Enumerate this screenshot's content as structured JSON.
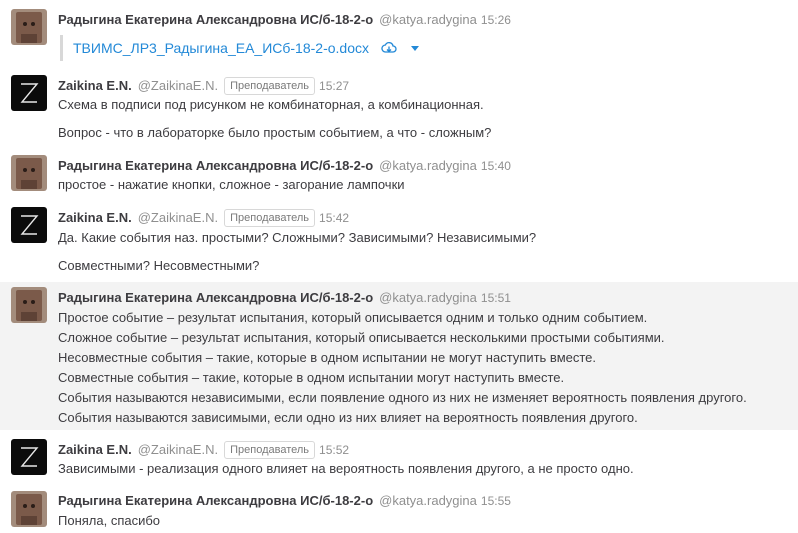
{
  "file": {
    "name": "ТВИМС_ЛР3_Радыгина_ЕА_ИСб-18-2-о.docx",
    "download_icon": "cloud-download-icon",
    "menu_icon": "caret-down-icon"
  },
  "posts": [
    {
      "name": "Радыгина Екатерина Александровна ИС/б-18-2-о",
      "handle": "@katya.radygina",
      "time": "15:26",
      "avatar": "avatar-photo"
    },
    {
      "name": "Zaikina E.N.",
      "handle": "@ZaikinaE.N.",
      "badge": "Преподаватель",
      "time": "15:27",
      "avatar": "avatar-logo",
      "lines": [
        "Схема в подписи под рисунком не комбинаторная, а комбинационная.",
        "Вопрос - что в лабораторке было простым событием, а что - сложным?"
      ]
    },
    {
      "name": "Радыгина Екатерина Александровна ИС/б-18-2-о",
      "handle": "@katya.radygina",
      "time": "15:40",
      "avatar": "avatar-photo",
      "lines": [
        "простое - нажатие кнопки, сложное - загорание лампочки"
      ]
    },
    {
      "name": "Zaikina E.N.",
      "handle": "@ZaikinaE.N.",
      "badge": "Преподаватель",
      "time": "15:42",
      "avatar": "avatar-logo",
      "lines": [
        "Да. Какие события наз. простыми? Сложными? Зависимыми? Независимыми?",
        "Совместными? Несовместными?"
      ]
    },
    {
      "name": "Радыгина Екатерина Александровна ИС/б-18-2-о",
      "handle": "@katya.radygina",
      "time": "15:51",
      "avatar": "avatar-photo",
      "lines": [
        "Простое событие – результат испытания, который описывается одним и только одним событием.",
        "Сложное событие – результат испытания, который описывается несколькими простыми событиями.",
        "Несовместные события – такие, которые в одном испытании не могут наступить вместе.",
        "Совместные события – такие, которые в одном испытании могут наступить вместе.",
        "События называются независимыми, если появление одного из них не изменяет вероятность появления другого.",
        "События называются зависимыми, если одно из них влияет на вероятность появления другого."
      ]
    },
    {
      "name": "Zaikina E.N.",
      "handle": "@ZaikinaE.N.",
      "badge": "Преподаватель",
      "time": "15:52",
      "avatar": "avatar-logo",
      "lines": [
        "Зависимыми - реализация одного влияет на вероятность появления другого, а не просто одно."
      ]
    },
    {
      "name": "Радыгина Екатерина Александровна ИС/б-18-2-о",
      "handle": "@katya.radygina",
      "time": "15:55",
      "avatar": "avatar-photo",
      "lines": [
        "Поняла, спасибо"
      ]
    }
  ]
}
